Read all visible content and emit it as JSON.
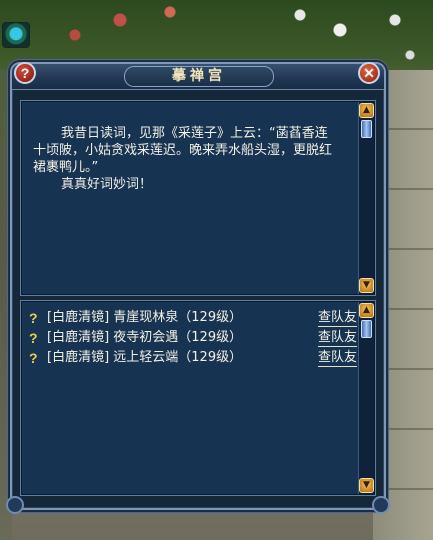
{
  "window": {
    "title": "摹禅宫",
    "help_label": "?",
    "close_label": "✕"
  },
  "dialogue": {
    "lines": [
      "我昔日读词，见那《采莲子》上云：“菡萏香连",
      "十顷陂，小姑贪戏采莲迟。晚来弄水船头湿，更脱红",
      "裙裹鸭儿。”",
      "真真好词妙词！"
    ]
  },
  "quests": [
    {
      "icon": "?",
      "name": "[白鹿清镜] 青崖现林泉（129级）",
      "action": "查队友"
    },
    {
      "icon": "?",
      "name": "[白鹿清镜] 夜寺初会遇（129级）",
      "action": "查队友"
    },
    {
      "icon": "?",
      "name": "[白鹿清镜] 远上轻云端（129级）",
      "action": "查队友"
    }
  ],
  "scroll": {
    "up_icon": "▲",
    "down_icon": "▼"
  },
  "colors": {
    "panel_bg": "#173352",
    "title_text": "#f1e4b8",
    "quest_icon": "#e9d244"
  }
}
